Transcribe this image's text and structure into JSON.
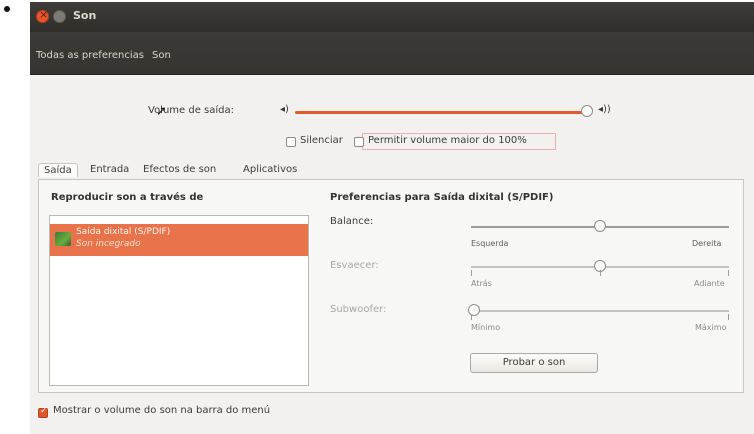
{
  "window": {
    "title": "Son",
    "close_color": "#e8542b"
  },
  "toolbar": {
    "all_prefs": "Todas as preferencias",
    "current": "Son"
  },
  "output": {
    "volume_label": "Volume de saída:",
    "volume_level": 1.0,
    "mute_label": "Silenciar",
    "mute_checked": false,
    "allow_over_label": "Permitir volume maior do 100%",
    "allow_over_checked": false
  },
  "tabs": [
    "Saída",
    "Entrada",
    "Efectos de son",
    "Aplicativos"
  ],
  "active_tab": "Saída",
  "left_panel": {
    "title": "Reproducir son a través de",
    "devices": [
      {
        "name": "Saída dixital (S/PDIF)",
        "subtitle": "Son incegrado"
      }
    ]
  },
  "right_panel": {
    "title": "Preferencias para Saída dixital (S/PDIF)",
    "balance": {
      "label": "Balance:",
      "left": "Esquerda",
      "right": "Dereita",
      "value": 0.5
    },
    "fade": {
      "label": "Esvaecer:",
      "left": "Atrás",
      "right": "Adiante",
      "value": 0.5
    },
    "subwoofer": {
      "label": "Subwoofer:",
      "left": "Mínimo",
      "right": "Máximo",
      "value": 0.0
    },
    "test_button": "Probar o son"
  },
  "show_volume": {
    "label": "Mostrar o volume do son na barra do menú",
    "checked": true
  },
  "accent_color": "#e2562a",
  "icons": {
    "speaker_low": "speaker-low-icon",
    "speaker_high": "speaker-high-icon"
  }
}
